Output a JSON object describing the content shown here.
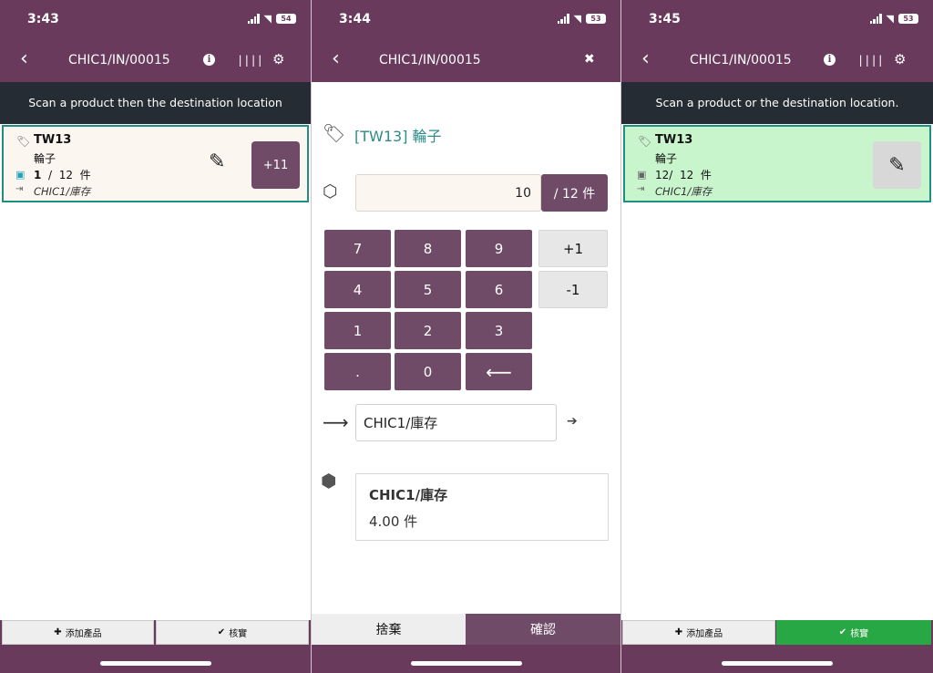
{
  "screen1": {
    "status_time": "3:43",
    "battery": "54",
    "nav_title": "CHIC1/IN/00015",
    "banner": "Scan a product then the destination location",
    "line": {
      "code": "TW13",
      "name": "輪子",
      "qty_done": "1",
      "qty_sep": "/",
      "qty_total": "12",
      "uom": "件",
      "location": "CHIC1/庫存"
    },
    "plus_button": "+11",
    "add_product_label": "添加產品",
    "validate_label": "核實"
  },
  "screen2": {
    "status_time": "3:44",
    "battery": "53",
    "nav_title": "CHIC1/IN/00015",
    "product_title": "[TW13] 輪子",
    "qty_value": "10",
    "qty_unit": "/ 12 件",
    "keypad": {
      "k7": "7",
      "k8": "8",
      "k9": "9",
      "plus1": "+1",
      "k4": "4",
      "k5": "5",
      "k6": "6",
      "minus1": "-1",
      "k1": "1",
      "k2": "2",
      "k3": "3",
      "dot": ".",
      "k0": "0",
      "backspace": "⟵"
    },
    "destination_value": "CHIC1/庫存",
    "stock": {
      "location": "CHIC1/庫存",
      "quantity": "4.00 件"
    },
    "discard_label": "捨棄",
    "confirm_label": "確認"
  },
  "screen3": {
    "status_time": "3:45",
    "battery": "53",
    "nav_title": "CHIC1/IN/00015",
    "banner": "Scan a product or the destination location.",
    "line": {
      "code": "TW13",
      "name": "輪子",
      "qty_done": "12",
      "qty_sep": "/",
      "qty_total": "12",
      "uom": "件",
      "location": "CHIC1/庫存"
    },
    "add_product_label": "添加產品",
    "validate_label": "核實"
  },
  "colors": {
    "brand": "#6a3a5d",
    "button": "#704b67",
    "banner": "#252c33",
    "teal": "#1f8f84",
    "success": "#28a745",
    "done_line": "#c9f5cd"
  },
  "icons": [
    "back-icon",
    "info-icon",
    "barcode-icon",
    "gear-icon",
    "close-icon",
    "tag-icon",
    "box-icon",
    "pencil-icon",
    "location-icon",
    "arrow-right-icon",
    "boxes-icon",
    "plus-icon",
    "check-icon"
  ]
}
